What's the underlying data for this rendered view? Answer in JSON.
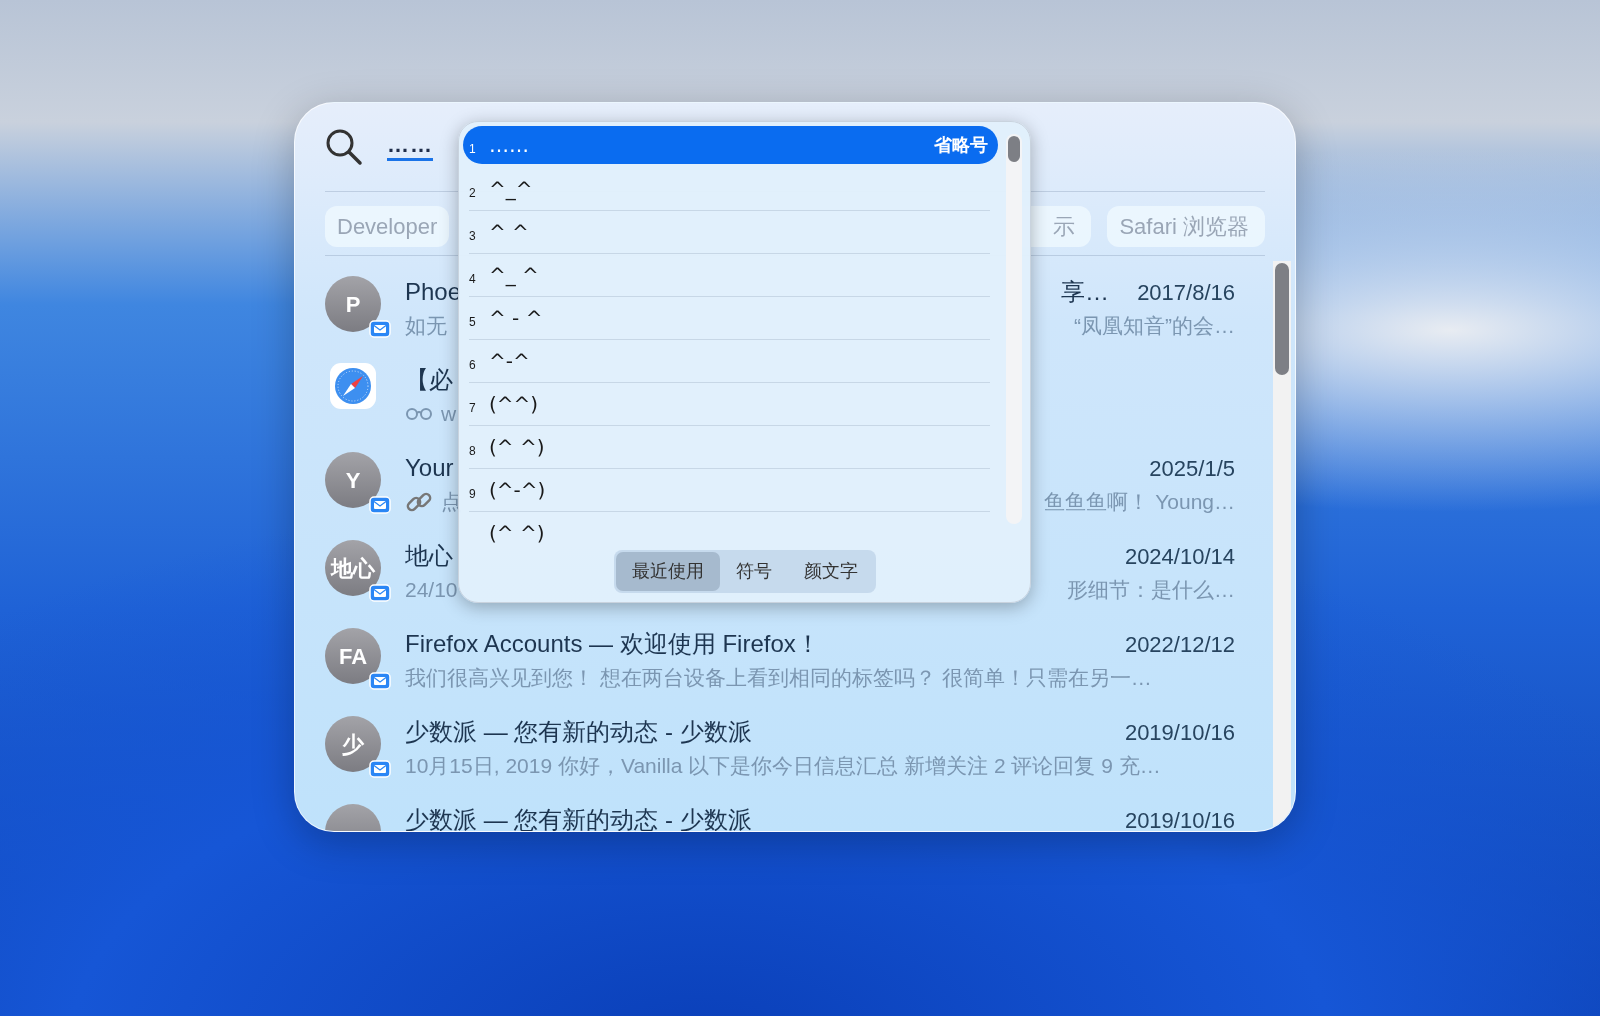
{
  "search": {
    "query": "……"
  },
  "filters": [
    {
      "label": "Developer"
    },
    {
      "label": "示"
    },
    {
      "label": "Safari 浏览器"
    }
  ],
  "results": [
    {
      "kind": "contact",
      "avatar": "P",
      "title": "Phoe",
      "title_end": "享…",
      "date": "2017/8/16",
      "subtitle": "如无",
      "subtitle_end": "“凤凰知音”的会…"
    },
    {
      "kind": "app",
      "title": "【必",
      "subtitle_badge": {
        "kind": "glasses"
      },
      "subtitle": "w"
    },
    {
      "kind": "contact",
      "avatar": "Y",
      "title": "Your",
      "date": "2025/1/5",
      "subtitle_badge": {
        "kind": "link"
      },
      "subtitle": "点",
      "subtitle_end": "鱼鱼鱼啊！ Young…"
    },
    {
      "kind": "contact",
      "avatar": "地心",
      "title": "地心",
      "date": "2024/10/14",
      "subtitle": "24/10",
      "subtitle_end": "形细节：是什么…"
    },
    {
      "kind": "contact",
      "avatar": "FA",
      "title": "Firefox Accounts — 欢迎使用 Firefox！",
      "date": "2022/12/12",
      "subtitle": "我们很高兴见到您！ 想在两台设备上看到相同的标签吗？ 很简单！只需在另一…"
    },
    {
      "kind": "contact",
      "avatar": "少",
      "title": "少数派 — 您有新的动态 - 少数派",
      "date": "2019/10/16",
      "subtitle": "10月15日, 2019 你好，Vanilla 以下是你今日信息汇总 新增关注 2 评论回复 9 充…"
    },
    {
      "kind": "contact",
      "title": "少数派 — 您有新的动态 - 少数派",
      "date": "2019/10/16"
    }
  ],
  "candidates": [
    {
      "number": "1",
      "text": "……",
      "annotation": "省略号",
      "selected": true
    },
    {
      "number": "2",
      "text": "^_^",
      "selected": false
    },
    {
      "number": "3",
      "text": "^ ^",
      "selected": false
    },
    {
      "number": "4",
      "text": "^_ ^",
      "selected": false
    },
    {
      "number": "5",
      "text": "^ - ^",
      "selected": false
    },
    {
      "number": "6",
      "text": "^-^",
      "selected": false
    },
    {
      "number": "7",
      "text": "(^^)",
      "selected": false
    },
    {
      "number": "8",
      "text": "(^ ^)",
      "selected": false
    },
    {
      "number": "9",
      "text": "(^-^)",
      "selected": false
    },
    {
      "text": "(^ ^)",
      "selected": false
    }
  ],
  "candidate_tabs": [
    {
      "label": "最近使用",
      "selected": true
    },
    {
      "label": "符号",
      "selected": false
    },
    {
      "label": "颜文字",
      "selected": false
    }
  ]
}
